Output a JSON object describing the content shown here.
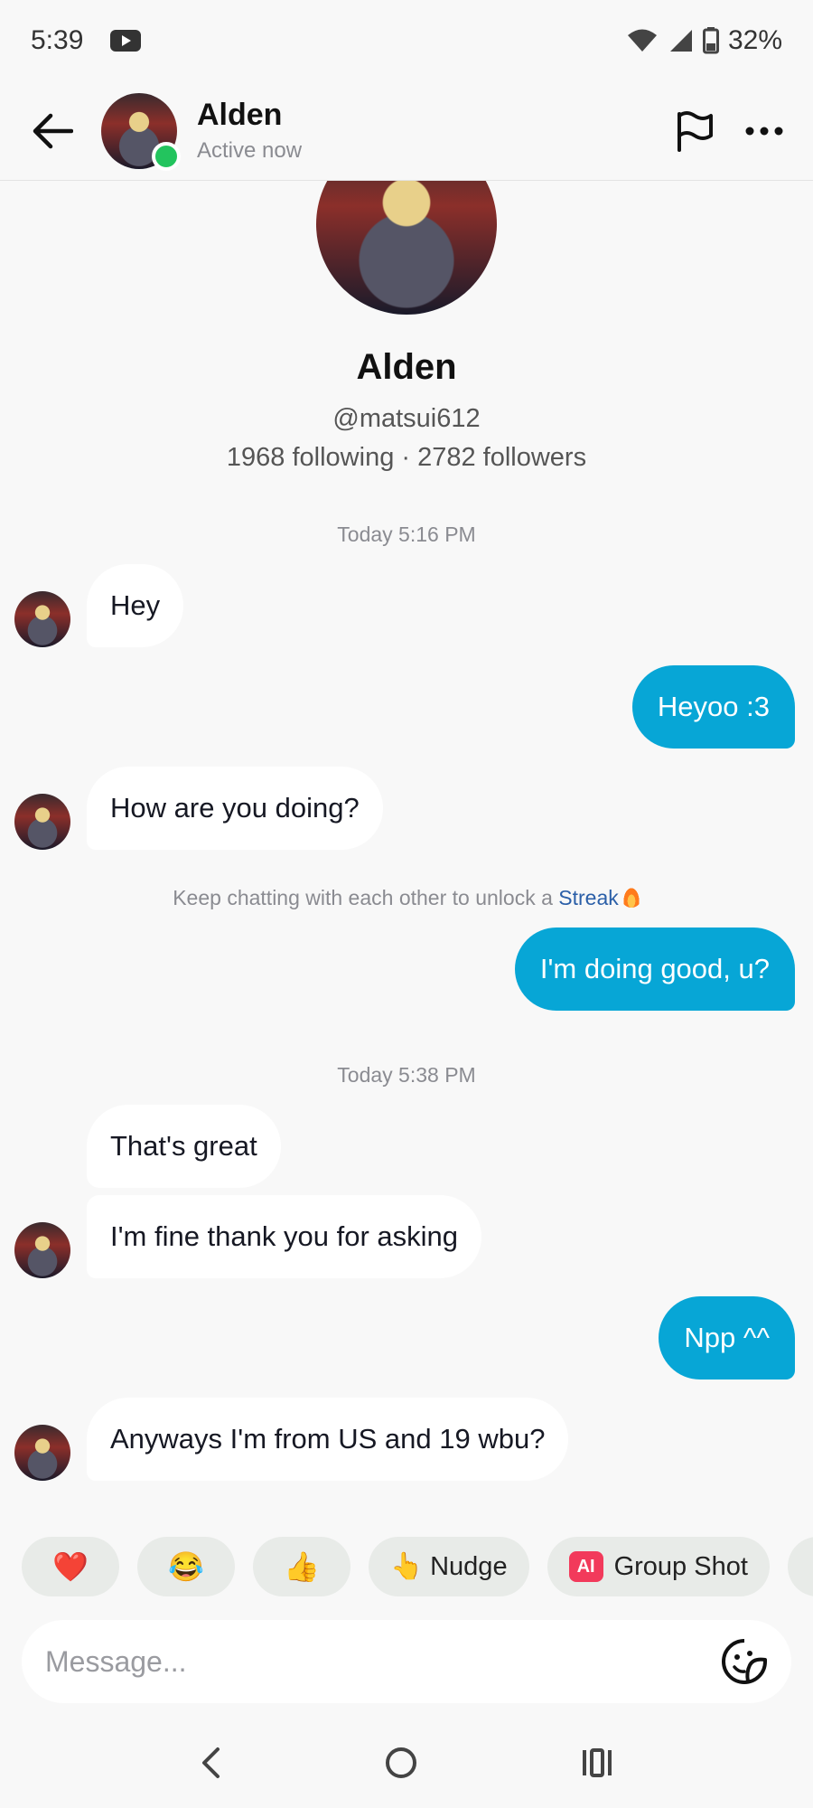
{
  "status_bar": {
    "time": "5:39",
    "battery": "32%",
    "icons": [
      "youtube-icon",
      "wifi-icon",
      "signal-icon",
      "battery-icon"
    ]
  },
  "header": {
    "name": "Alden",
    "status": "Active now",
    "online_color": "#23c45e",
    "icons": [
      "back-arrow-icon",
      "flag-icon",
      "more-icon"
    ]
  },
  "profile": {
    "name": "Alden",
    "handle": "@matsui612",
    "stats": "1968 following · 2782 followers"
  },
  "timestamps": {
    "first": "Today 5:16 PM",
    "second": "Today 5:38 PM"
  },
  "hint": {
    "text": "Keep chatting with each other to unlock a ",
    "link": "Streak"
  },
  "messages": [
    {
      "from": "them",
      "text": "Hey"
    },
    {
      "from": "me",
      "text": "Heyoo :3"
    },
    {
      "from": "them",
      "text": "How are you doing?"
    },
    {
      "from": "me",
      "text": "I'm doing good, u?"
    },
    {
      "from": "them",
      "text": "That's great"
    },
    {
      "from": "them",
      "text": "I'm fine thank you for asking"
    },
    {
      "from": "me",
      "text": "Npp ^^"
    },
    {
      "from": "them",
      "text": "Anyways I'm from US and 19 wbu?"
    }
  ],
  "quick_replies": {
    "heart": "❤️",
    "laugh": "😂",
    "thumbs": "👍",
    "nudge_emoji": "👆",
    "nudge": "Nudge",
    "ai_badge": "AI",
    "group_shot": "Group Shot"
  },
  "composer": {
    "placeholder": "Message..."
  },
  "colors": {
    "outgoing_bubble": "#07a6d6",
    "incoming_bubble": "#ffffff",
    "background": "#f8f8f8"
  }
}
